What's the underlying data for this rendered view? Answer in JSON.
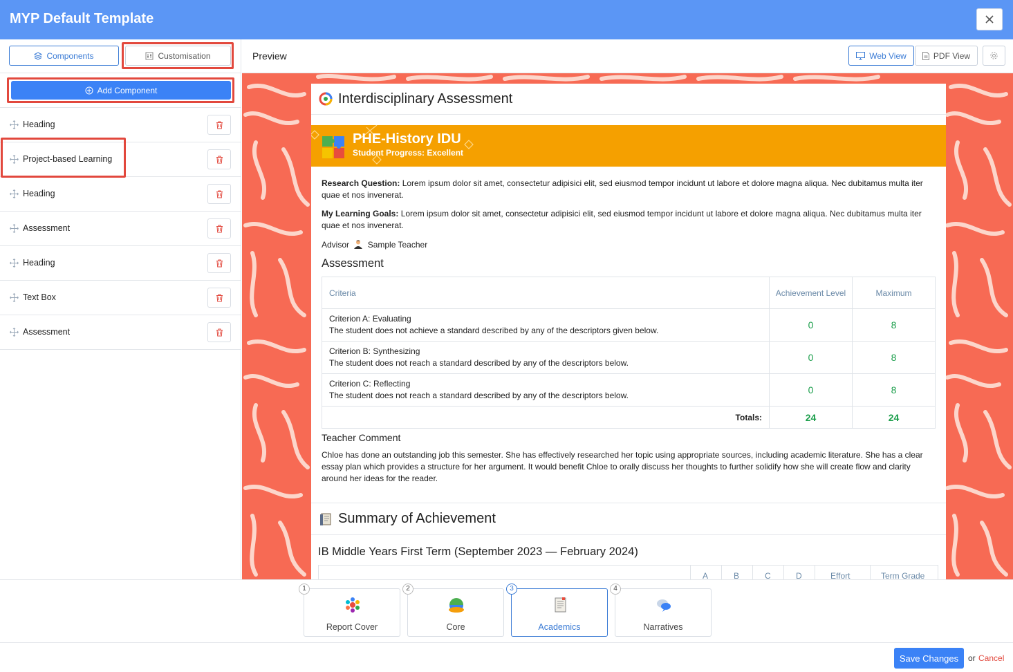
{
  "modal": {
    "title": "MYP Default Template"
  },
  "left": {
    "tabs": {
      "components": "Components",
      "customisation": "Customisation"
    },
    "add_component": "Add Component",
    "items": [
      {
        "label": "Heading"
      },
      {
        "label": "Project-based Learning"
      },
      {
        "label": "Heading"
      },
      {
        "label": "Assessment"
      },
      {
        "label": "Heading"
      },
      {
        "label": "Text Box"
      },
      {
        "label": "Assessment"
      }
    ]
  },
  "preview": {
    "title": "Preview",
    "web_view": "Web View",
    "pdf_view": "PDF View"
  },
  "report": {
    "section1_title": "Interdisciplinary Assessment",
    "banner_title": "PHE-History IDU",
    "banner_subtitle": "Student Progress: Excellent",
    "research_label": "Research Question:",
    "research_text": " Lorem ipsum dolor sit amet, consectetur adipisici elit, sed eiusmod tempor incidunt ut labore et dolore magna aliqua. Nec dubitamus multa iter quae et nos invenerat.",
    "goals_label": "My Learning Goals:",
    "goals_text": " Lorem ipsum dolor sit amet, consectetur adipisici elit, sed eiusmod tempor incidunt ut labore et dolore magna aliqua. Nec dubitamus multa iter quae et nos invenerat.",
    "advisor_label": "Advisor",
    "advisor_name": "Sample Teacher",
    "assessment_heading": "Assessment",
    "table_headers": {
      "criteria": "Criteria",
      "achievement": "Achievement Level",
      "maximum": "Maximum"
    },
    "criteria": [
      {
        "name": "Criterion A: Evaluating",
        "desc": "The student does not achieve a standard described by any of the descriptors given below.",
        "level": "0",
        "max": "8"
      },
      {
        "name": "Criterion B: Synthesizing",
        "desc": "The student does not reach a standard described by any of the descriptors below.",
        "level": "0",
        "max": "8"
      },
      {
        "name": "Criterion C: Reflecting",
        "desc": "The student does not reach a standard described by any of the descriptors below.",
        "level": "0",
        "max": "8"
      }
    ],
    "totals_label": "Totals:",
    "total_level": "24",
    "total_max": "24",
    "teacher_comment_label": "Teacher Comment",
    "teacher_comment": "Chloe has done an outstanding job this semester. She has effectively researched her topic using appropriate sources, including academic literature. She has a clear essay plan which provides a structure for her argument. It would benefit Chloe to orally discuss her thoughts to further solidify how she will create flow and clarity around her ideas for the reader.",
    "section2_title": "Summary of Achievement",
    "term_title": "IB Middle Years First Term (September 2023 — February 2024)",
    "summary_headers": [
      "A",
      "B",
      "C",
      "D",
      "Effort",
      "Term Grade"
    ]
  },
  "steps": [
    {
      "num": "1",
      "label": "Report Cover"
    },
    {
      "num": "2",
      "label": "Core"
    },
    {
      "num": "3",
      "label": "Academics"
    },
    {
      "num": "4",
      "label": "Narratives"
    }
  ],
  "footer": {
    "save": "Save Changes",
    "or": "or",
    "cancel": "Cancel"
  },
  "colors": {
    "header": "#5b96f5",
    "primary": "#3b82f6",
    "banner": "#f5a000",
    "background_pattern": "#f76a54",
    "highlight": "#e2483d",
    "score": "#1b9e4b"
  }
}
